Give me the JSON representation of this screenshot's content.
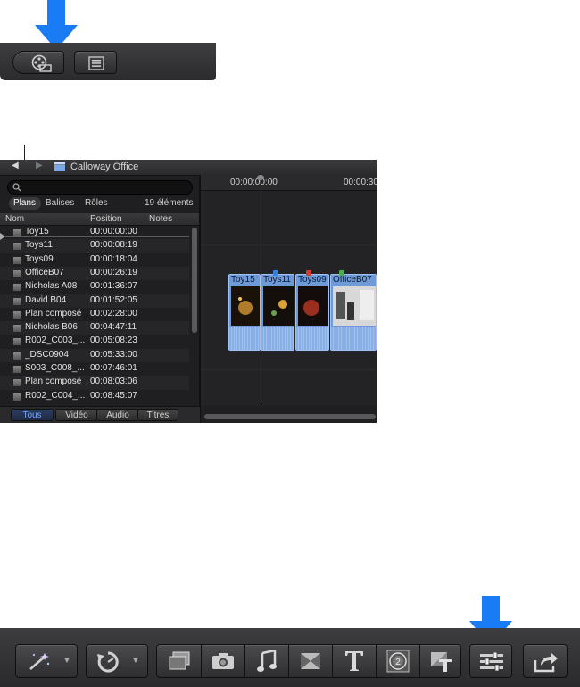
{
  "timeline_index": {
    "project_title": "Calloway Office",
    "search": {
      "placeholder": ""
    },
    "tabs": [
      "Plans",
      "Balises",
      "Rôles"
    ],
    "item_count": "19 éléments",
    "columns": [
      "Nom",
      "Position",
      "Notes"
    ],
    "rows": [
      {
        "name": "Toy15",
        "position": "00:00:00:00"
      },
      {
        "name": "Toys11",
        "position": "00:00:08:19"
      },
      {
        "name": "Toys09",
        "position": "00:00:18:04"
      },
      {
        "name": "OfficeB07",
        "position": "00:00:26:19"
      },
      {
        "name": "Nicholas A08",
        "position": "00:01:36:07"
      },
      {
        "name": "David B04",
        "position": "00:01:52:05"
      },
      {
        "name": "Plan composé",
        "position": "00:02:28:00"
      },
      {
        "name": "Nicholas B06",
        "position": "00:04:47:11"
      },
      {
        "name": "R002_C003_...",
        "position": "00:05:08:23"
      },
      {
        "name": "_DSC0904",
        "position": "00:05:33:00"
      },
      {
        "name": "S003_C008_...",
        "position": "00:07:46:01"
      },
      {
        "name": "Plan composé",
        "position": "00:08:03:06"
      },
      {
        "name": "R002_C004_...",
        "position": "00:08:45:07"
      }
    ],
    "filter_tabs": [
      "Tous",
      "Vidéo",
      "Audio",
      "Titres"
    ],
    "selected_filter": "Tous"
  },
  "timeline": {
    "timecodes": [
      "00:00:00:00",
      "00:00:30"
    ],
    "clips": [
      "Toy15",
      "Toys11",
      "Toys09",
      "OfficeB07"
    ]
  },
  "colors": {
    "callout_arrow": "#1a7cf5",
    "clip_fill": "#6e9ad8",
    "selected_tab_text": "#6fa3ff"
  },
  "icons": {
    "top_toolbar": [
      "film-reel-icon",
      "index-list-icon"
    ],
    "bottom_toolbar": [
      "magic-wand-icon",
      "retime-icon",
      "video-effects-icon",
      "photo-icon",
      "music-icon",
      "transitions-icon",
      "title-icon",
      "generator-icon",
      "theme-icon",
      "inspector-sliders-icon",
      "share-icon"
    ]
  }
}
